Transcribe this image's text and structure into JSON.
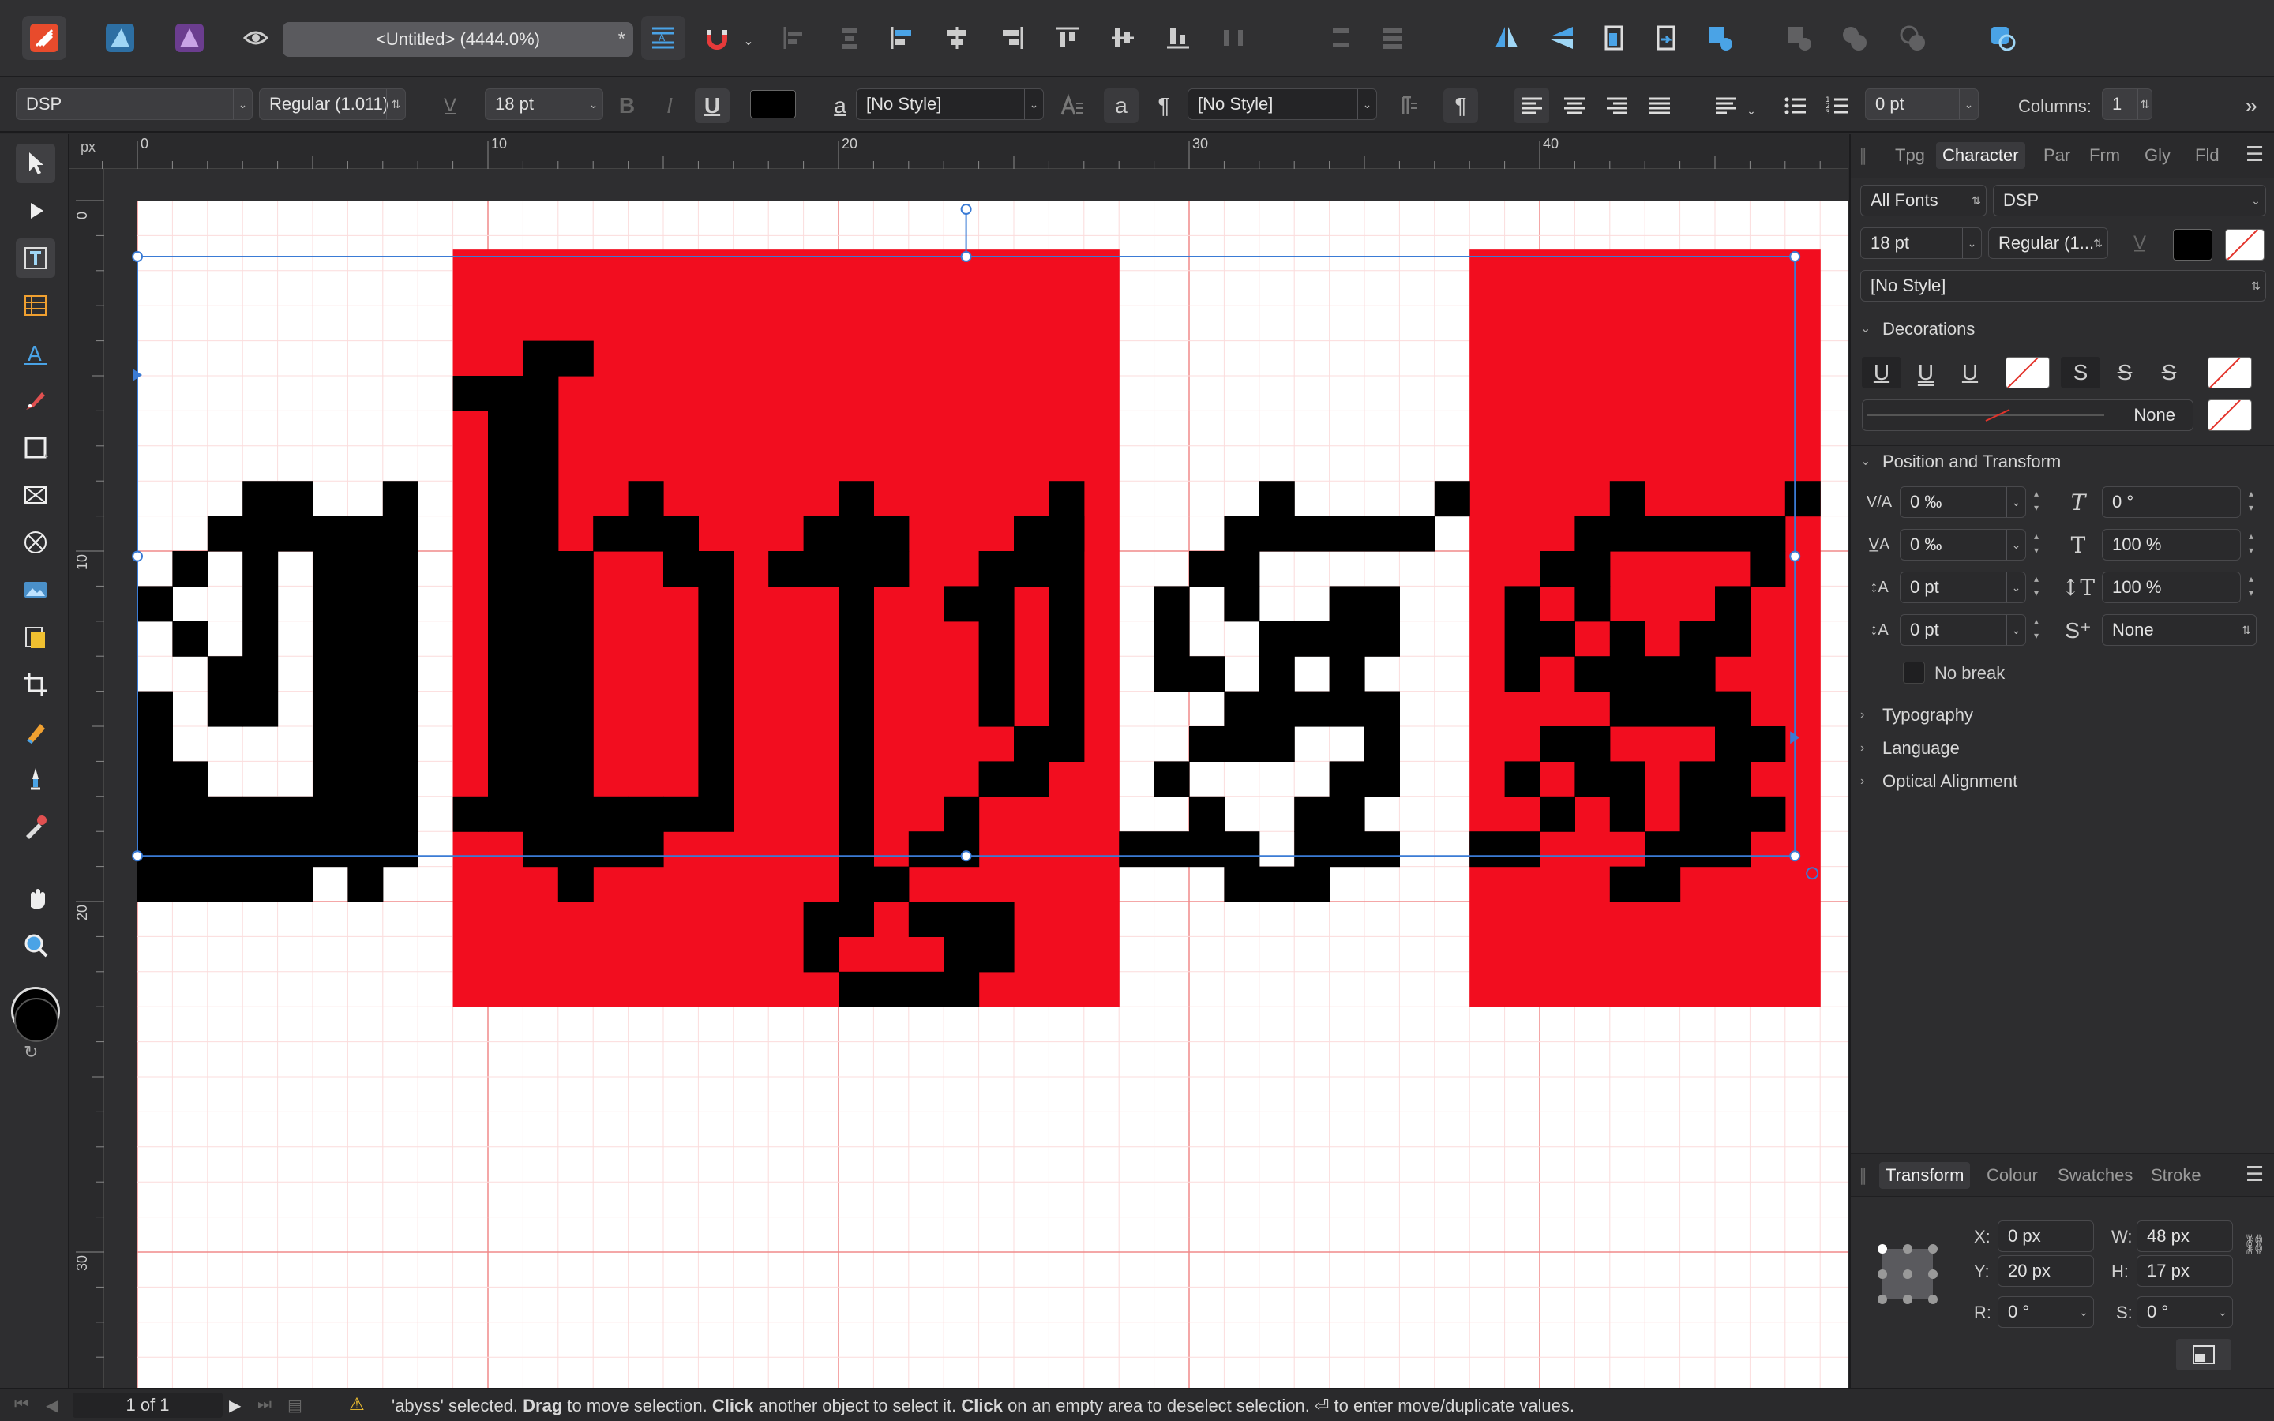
{
  "document": {
    "title": "<Untitled> (4444.0%)",
    "modified_mark": "*"
  },
  "context_toolbar": {
    "font_family": "DSP",
    "font_style": "Regular (1.011)",
    "font_size": "18 pt",
    "char_style": "[No Style]",
    "para_style": "[No Style]",
    "bold": "B",
    "italic": "I",
    "underline": "U",
    "char_style_glyph": "a",
    "para_style_glyph": "a",
    "pilcrow": "¶",
    "space_value": "0 pt",
    "columns_label": "Columns:",
    "columns_value": "1",
    "text_color": "#000000"
  },
  "ruler": {
    "unit": "px",
    "h_ticks": [
      "0",
      "10",
      "20",
      "30",
      "40"
    ],
    "v_ticks": [
      "0",
      "10",
      "20",
      "30"
    ]
  },
  "canvas": {
    "text": "abyss",
    "highlight_color": "#f20d1f",
    "glyph_color": "#000000"
  },
  "character_panel": {
    "tabs": [
      "Tpg",
      "Character",
      "Par",
      "Frm",
      "Gly",
      "Fld"
    ],
    "active_tab": "Character",
    "font_collection": "All Fonts",
    "font_family": "DSP",
    "font_size": "18 pt",
    "font_style": "Regular (1...",
    "style": "[No Style]",
    "decorations": {
      "title": "Decorations",
      "u1": "U",
      "u2": "U",
      "u3": "U",
      "s1": "S",
      "s2": "S",
      "s3": "S",
      "line_value": "None"
    },
    "position_transform": {
      "title": "Position and Transform",
      "tracking": "0 ‰",
      "kerning": "0 ‰",
      "baseline": "0 pt",
      "leading": "0 pt",
      "shear": "0 °",
      "scale_h": "100 %",
      "scale_v": "100 %",
      "typeface_style": "None",
      "no_break": "No break"
    },
    "collapsed_sections": [
      "Typography",
      "Language",
      "Optical Alignment"
    ]
  },
  "transform_panel": {
    "tabs": [
      "Transform",
      "Colour",
      "Swatches",
      "Stroke"
    ],
    "active_tab": "Transform",
    "x_label": "X:",
    "x": "0 px",
    "y_label": "Y:",
    "y": "20 px",
    "w_label": "W:",
    "w": "48 px",
    "h_label": "H:",
    "h": "17 px",
    "r_label": "R:",
    "r": "0 °",
    "s_label": "S:",
    "s": "0 °"
  },
  "status": {
    "page": "1 of 1",
    "message_parts": [
      {
        "text": "'abyss' selected. ",
        "bold": false
      },
      {
        "text": "Drag",
        "bold": true
      },
      {
        "text": " to move selection. ",
        "bold": false
      },
      {
        "text": "Click",
        "bold": true
      },
      {
        "text": " another object to select it. ",
        "bold": false
      },
      {
        "text": "Click",
        "bold": true
      },
      {
        "text": " on an empty area to deselect selection. ⏎ to enter move/duplicate values.",
        "bold": false
      }
    ]
  }
}
